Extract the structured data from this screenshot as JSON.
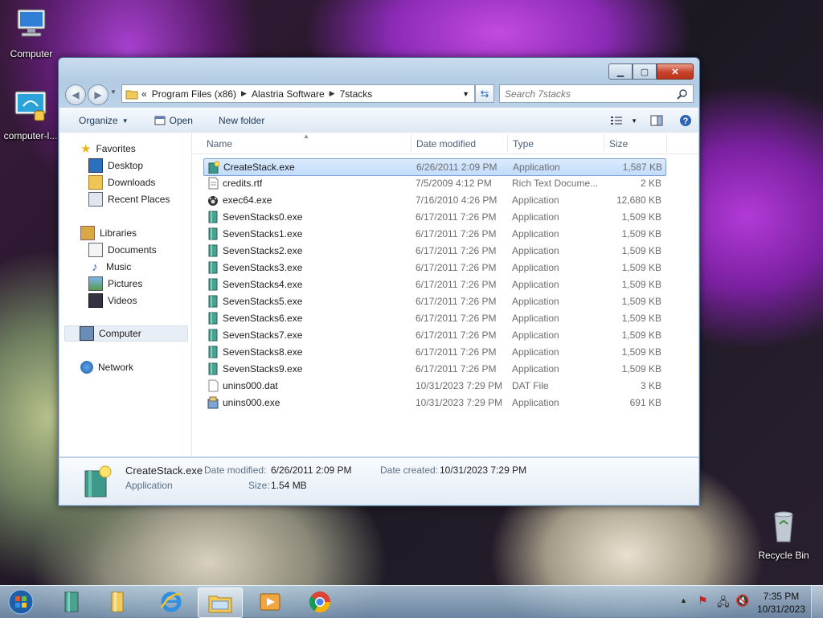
{
  "desktop": {
    "icons": [
      {
        "label": "Computer",
        "icon": "computer-icon"
      },
      {
        "label": "computer-l...",
        "icon": "network-drive-icon"
      },
      {
        "label": "Recycle Bin",
        "icon": "recycle-bin-icon"
      }
    ]
  },
  "window": {
    "caption_buttons": {
      "minimize": "minimize",
      "maximize": "maximize",
      "close": "close"
    },
    "address": {
      "prefix": "«",
      "crumbs": [
        "Program Files (x86)",
        "Alastria Software",
        "7stacks"
      ]
    },
    "search": {
      "placeholder": "Search 7stacks"
    },
    "toolbar": {
      "organize": "Organize",
      "open": "Open",
      "new_folder": "New folder"
    },
    "nav_pane": {
      "favorites": "Favorites",
      "desktop": "Desktop",
      "downloads": "Downloads",
      "recent_places": "Recent Places",
      "libraries": "Libraries",
      "documents": "Documents",
      "music": "Music",
      "pictures": "Pictures",
      "videos": "Videos",
      "computer": "Computer",
      "network": "Network"
    },
    "columns": {
      "name": "Name",
      "date": "Date modified",
      "type": "Type",
      "size": "Size"
    },
    "files": [
      {
        "name": "CreateStack.exe",
        "date": "6/26/2011 2:09 PM",
        "type": "Application",
        "size": "1,587 KB",
        "icon": "createstack-app-icon"
      },
      {
        "name": "credits.rtf",
        "date": "7/5/2009 4:12 PM",
        "type": "Rich Text Docume...",
        "size": "2 KB",
        "icon": "rtf-document-icon"
      },
      {
        "name": "exec64.exe",
        "date": "7/16/2010 4:26 PM",
        "type": "Application",
        "size": "12,680 KB",
        "icon": "paw-app-icon"
      },
      {
        "name": "SevenStacks0.exe",
        "date": "6/17/2011 7:26 PM",
        "type": "Application",
        "size": "1,509 KB",
        "icon": "sevenstacks-app-icon"
      },
      {
        "name": "SevenStacks1.exe",
        "date": "6/17/2011 7:26 PM",
        "type": "Application",
        "size": "1,509 KB",
        "icon": "sevenstacks-app-icon"
      },
      {
        "name": "SevenStacks2.exe",
        "date": "6/17/2011 7:26 PM",
        "type": "Application",
        "size": "1,509 KB",
        "icon": "sevenstacks-app-icon"
      },
      {
        "name": "SevenStacks3.exe",
        "date": "6/17/2011 7:26 PM",
        "type": "Application",
        "size": "1,509 KB",
        "icon": "sevenstacks-app-icon"
      },
      {
        "name": "SevenStacks4.exe",
        "date": "6/17/2011 7:26 PM",
        "type": "Application",
        "size": "1,509 KB",
        "icon": "sevenstacks-app-icon"
      },
      {
        "name": "SevenStacks5.exe",
        "date": "6/17/2011 7:26 PM",
        "type": "Application",
        "size": "1,509 KB",
        "icon": "sevenstacks-app-icon"
      },
      {
        "name": "SevenStacks6.exe",
        "date": "6/17/2011 7:26 PM",
        "type": "Application",
        "size": "1,509 KB",
        "icon": "sevenstacks-app-icon"
      },
      {
        "name": "SevenStacks7.exe",
        "date": "6/17/2011 7:26 PM",
        "type": "Application",
        "size": "1,509 KB",
        "icon": "sevenstacks-app-icon"
      },
      {
        "name": "SevenStacks8.exe",
        "date": "6/17/2011 7:26 PM",
        "type": "Application",
        "size": "1,509 KB",
        "icon": "sevenstacks-app-icon"
      },
      {
        "name": "SevenStacks9.exe",
        "date": "6/17/2011 7:26 PM",
        "type": "Application",
        "size": "1,509 KB",
        "icon": "sevenstacks-app-icon"
      },
      {
        "name": "unins000.dat",
        "date": "10/31/2023 7:29 PM",
        "type": "DAT File",
        "size": "3 KB",
        "icon": "blank-file-icon"
      },
      {
        "name": "unins000.exe",
        "date": "10/31/2023 7:29 PM",
        "type": "Application",
        "size": "691 KB",
        "icon": "installer-app-icon"
      }
    ],
    "selected_file_index": 0,
    "details": {
      "name": "CreateStack.exe",
      "type": "Application",
      "date_modified_label": "Date modified:",
      "date_modified": "6/26/2011 2:09 PM",
      "size_label": "Size:",
      "size": "1.54 MB",
      "date_created_label": "Date created:",
      "date_created": "10/31/2023 7:29 PM"
    }
  },
  "taskbar": {
    "apps": [
      "start-orb-icon",
      "sevenstacks-taskbar-icon",
      "folder-stack-icon",
      "internet-explorer-icon",
      "windows-explorer-icon",
      "media-player-icon",
      "chrome-icon"
    ],
    "clock": {
      "time": "7:35 PM",
      "date": "10/31/2023"
    }
  },
  "colors": {
    "selection": "#c1dcfc",
    "selection_border": "#7da2ce",
    "close_button": "#c6432a",
    "link_blue": "#1e395b"
  }
}
